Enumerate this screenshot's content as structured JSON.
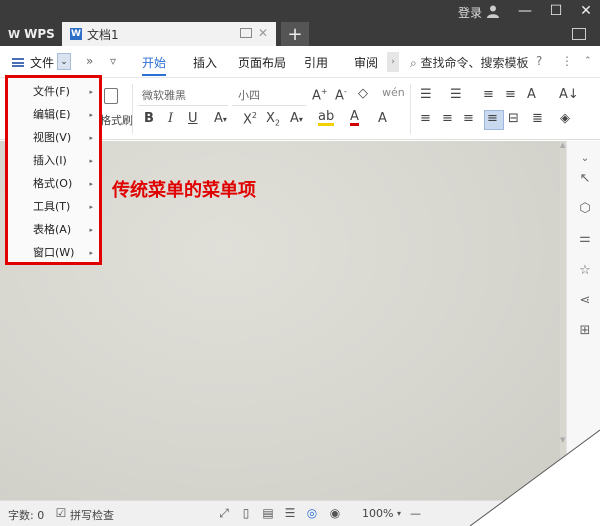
{
  "titlebar": {
    "app_name": "WPS",
    "doc_tab_label": "文档1",
    "doc_icon_letter": "W",
    "close_glyph": "✕",
    "new_tab_glyph": "+",
    "login_label": "登录",
    "minimize_glyph": "—",
    "maximize_glyph": "☐",
    "close_window_glyph": "✕"
  },
  "tabrow": {
    "file_label": "文件",
    "dropdown_glyph": "⌄",
    "more_glyph": "»",
    "customize_glyph": "▿",
    "tabs": [
      {
        "label": "开始"
      },
      {
        "label": "插入"
      },
      {
        "label": "页面布局"
      },
      {
        "label": "引用"
      },
      {
        "label": "审阅"
      }
    ],
    "expand_glyph": "›",
    "search_label": "查找命令、搜索模板",
    "help_glyph": "?",
    "options_glyph": "⋮"
  },
  "ribbon": {
    "brush_label": "格式刷",
    "font_name": "微软雅黑",
    "font_size": "小四",
    "bold": "B",
    "italic": "I",
    "underline": "U",
    "grow_font": "A⁺",
    "shrink_font": "A⁻"
  },
  "classic_menu": {
    "items": [
      {
        "label": "文件(F)"
      },
      {
        "label": "编辑(E)"
      },
      {
        "label": "视图(V)"
      },
      {
        "label": "插入(I)"
      },
      {
        "label": "格式(O)"
      },
      {
        "label": "工具(T)"
      },
      {
        "label": "表格(A)"
      },
      {
        "label": "窗口(W)"
      }
    ],
    "arrow_glyph": "▸"
  },
  "annotation": {
    "text": "传统菜单的菜单项",
    "color": "#e00000"
  },
  "statusbar": {
    "word_count": "字数: 0",
    "spell_check": "拼写检查",
    "zoom": "100%",
    "zoom_out": "—"
  },
  "colors": {
    "accent": "#2a6fd6",
    "titlebar": "#3b3b3b",
    "highlight_box": "#e00000"
  }
}
